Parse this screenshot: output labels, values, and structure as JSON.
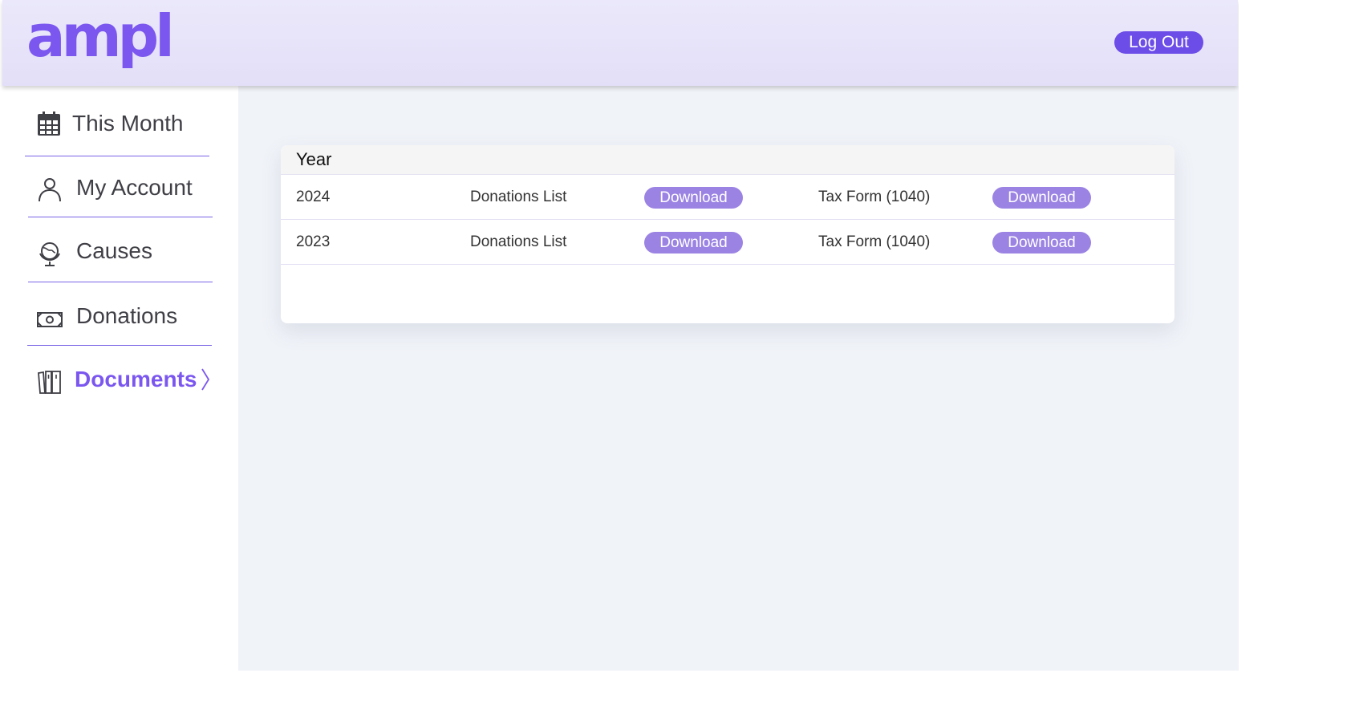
{
  "header": {
    "logo_text": "ampl",
    "logout_label": "Log Out",
    "brand_color": "#7b57ef"
  },
  "sidebar": {
    "items": [
      {
        "label": "This Month",
        "icon": "calendar-icon",
        "active": false
      },
      {
        "label": "My Account",
        "icon": "user-icon",
        "active": false
      },
      {
        "label": "Causes",
        "icon": "globe-icon",
        "active": false
      },
      {
        "label": "Donations",
        "icon": "money-icon",
        "active": false
      },
      {
        "label": "Documents",
        "icon": "books-icon",
        "active": true
      }
    ],
    "active_indicator_icon": "chevron-right-icon"
  },
  "documents_table": {
    "header": {
      "year": "Year"
    },
    "rows": [
      {
        "year": "2024",
        "donations_label": "Donations List",
        "donations_button": "Download",
        "tax_label": "Tax Form (1040)",
        "tax_button": "Download"
      },
      {
        "year": "2023",
        "donations_label": "Donations List",
        "donations_button": "Download",
        "tax_label": "Tax Form (1040)",
        "tax_button": "Download"
      }
    ]
  },
  "colors": {
    "accent": "#6c4de8",
    "button_light": "#9b83e3",
    "main_background": "#f0f3f8",
    "header_background": "#e6e2f9"
  }
}
